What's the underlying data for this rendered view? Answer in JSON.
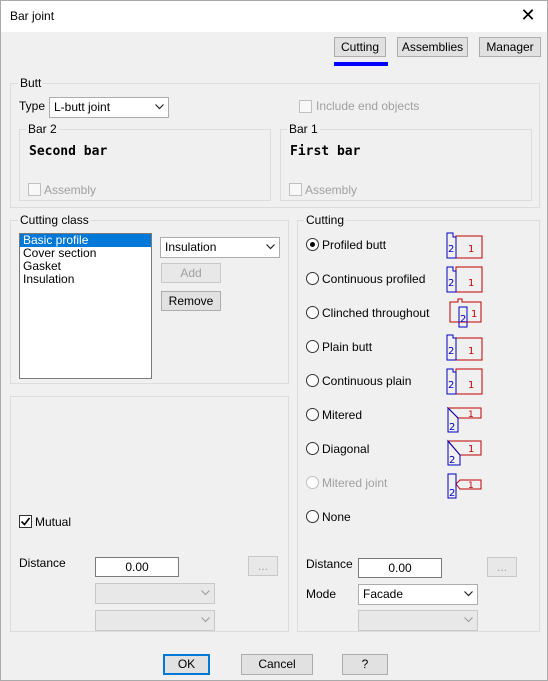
{
  "window": {
    "title": "Bar joint"
  },
  "tabs": [
    "Cutting",
    "Assemblies",
    "Manager"
  ],
  "butt": {
    "group_label": "Butt",
    "type_label": "Type",
    "type_value": "L-butt joint",
    "include_end_objects": "Include end objects",
    "bar2": {
      "label": "Bar 2",
      "name": "Second bar",
      "assembly": "Assembly"
    },
    "bar1": {
      "label": "Bar 1",
      "name": "First bar",
      "assembly": "Assembly"
    }
  },
  "cutting_class": {
    "label": "Cutting class",
    "items": [
      "Basic profile",
      "Cover section",
      "Gasket",
      "Insulation"
    ],
    "selected": "Basic profile",
    "combo_value": "Insulation",
    "add": "Add",
    "remove": "Remove"
  },
  "left_lower": {
    "mutual": "Mutual",
    "distance_label": "Distance",
    "distance_value": "0.00",
    "ellipsis": "..."
  },
  "cutting": {
    "label": "Cutting",
    "options": [
      "Profiled butt",
      "Continuous profiled",
      "Clinched throughout",
      "Plain butt",
      "Continuous plain",
      "Mitered",
      "Diagonal",
      "Mitered joint",
      "None"
    ],
    "selected": "Profiled butt",
    "disabled_option": "Mitered joint",
    "distance_label": "Distance",
    "distance_value": "0.00",
    "ellipsis": "...",
    "mode_label": "Mode",
    "mode_value": "Facade",
    "bar_numbers": {
      "one": "1",
      "two": "2"
    }
  },
  "footer": {
    "ok": "OK",
    "cancel": "Cancel",
    "help": "?"
  },
  "colors": {
    "accent": "#0000ff",
    "selection": "#0078d7",
    "bar1": "#c00000",
    "bar2": "#0000c0"
  }
}
